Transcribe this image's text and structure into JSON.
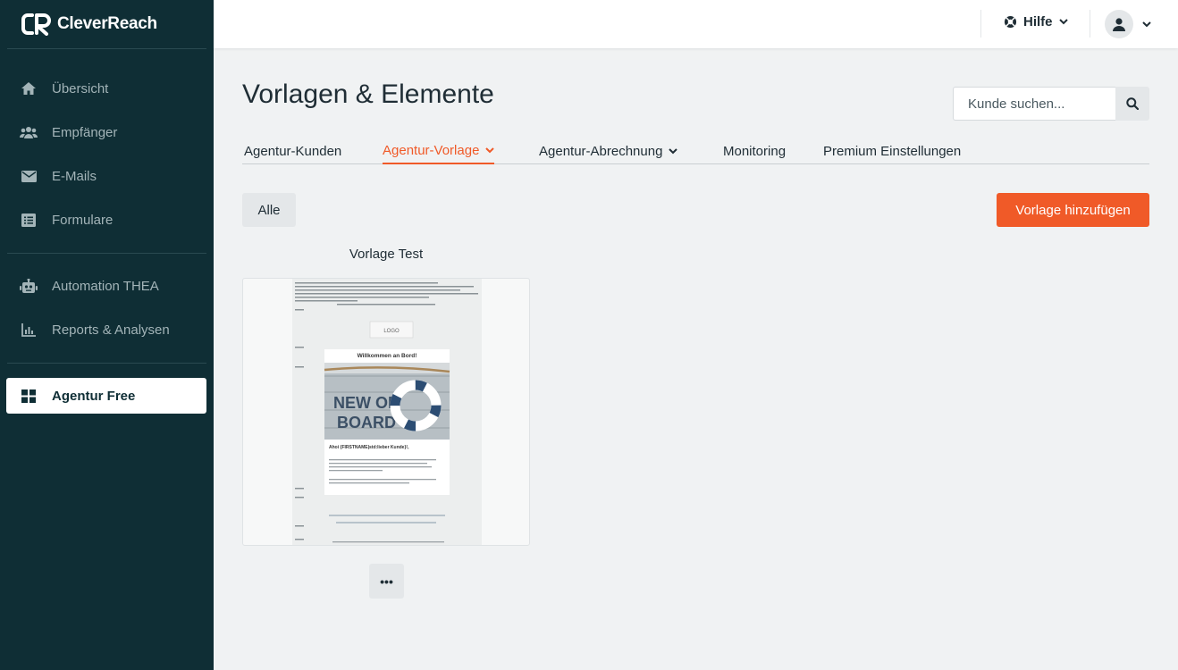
{
  "app": {
    "brand": "CleverReach"
  },
  "sidebar": {
    "items": [
      {
        "label": "Übersicht",
        "icon": "home-icon"
      },
      {
        "label": "Empfänger",
        "icon": "users-icon"
      },
      {
        "label": "E-Mails",
        "icon": "envelope-icon"
      },
      {
        "label": "Formulare",
        "icon": "form-icon"
      },
      {
        "label": "Automation THEA",
        "icon": "robot-icon"
      },
      {
        "label": "Reports & Analysen",
        "icon": "chart-icon"
      },
      {
        "label": "Agentur Free",
        "icon": "grid-icon",
        "active": true
      }
    ]
  },
  "header": {
    "help_label": "Hilfe"
  },
  "main": {
    "title": "Vorlagen & Elemente",
    "search": {
      "placeholder": "Kunde suchen..."
    },
    "tabs": [
      {
        "label": "Agentur-Kunden"
      },
      {
        "label": "Agentur-Vorlage",
        "active": true,
        "dropdown": true
      },
      {
        "label": "Agentur-Abrechnung",
        "dropdown": true
      },
      {
        "label": "Monitoring"
      },
      {
        "label": "Premium Einstellungen"
      }
    ],
    "filter_label": "Alle",
    "add_button_label": "Vorlage hinzufügen",
    "templates": [
      {
        "name": "Vorlage Test",
        "more_label": "•••",
        "preview": {
          "logo_text": "LOGO",
          "heading": "Willkommen an Bord!",
          "image_text_1": "NEW ON",
          "image_text_2": "BOARD",
          "greeting": "Ahoi {FIRSTNAME|std:lieber Kunde}!,"
        }
      }
    ]
  },
  "colors": {
    "sidebar": "#0f2e35",
    "accent": "#f05a28",
    "background": "#f0f2f3"
  }
}
